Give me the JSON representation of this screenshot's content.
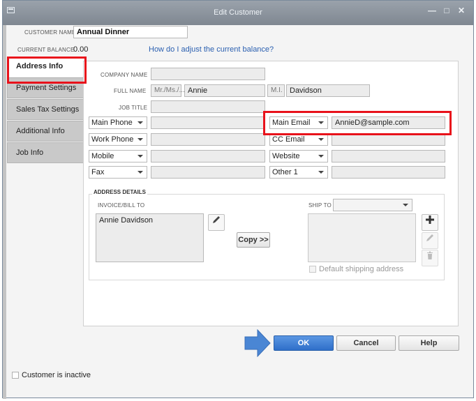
{
  "window": {
    "title": "Edit Customer",
    "minimize": "—",
    "restore": "□",
    "close": "✕"
  },
  "customer": {
    "name_label": "CUSTOMER NAME",
    "name_value": "Annual Dinner",
    "balance_label": "CURRENT BALANCE",
    "balance_value": "0.00",
    "balance_link": "How do I adjust the current balance?"
  },
  "tabs": [
    {
      "label": "Address Info"
    },
    {
      "label": "Payment Settings"
    },
    {
      "label": "Sales Tax Settings"
    },
    {
      "label": "Additional Info"
    },
    {
      "label": "Job Info"
    }
  ],
  "form": {
    "company_label": "COMPANY NAME",
    "company_value": "",
    "fullname_label": "FULL NAME",
    "salutation_placeholder": "Mr./Ms./...",
    "first_name": "Annie",
    "mi_placeholder": "M.I.",
    "last_name": "Davidson",
    "jobtitle_label": "JOB TITLE",
    "jobtitle_value": "",
    "phones": [
      {
        "type": "Main Phone",
        "value": ""
      },
      {
        "type": "Work Phone",
        "value": ""
      },
      {
        "type": "Mobile",
        "value": ""
      },
      {
        "type": "Fax",
        "value": ""
      }
    ],
    "contacts": [
      {
        "type": "Main Email",
        "value": "AnnieD@sample.com"
      },
      {
        "type": "CC Email",
        "value": ""
      },
      {
        "type": "Website",
        "value": ""
      },
      {
        "type": "Other 1",
        "value": ""
      }
    ]
  },
  "address": {
    "section_label": "ADDRESS DETAILS",
    "bill_label": "INVOICE/BILL TO",
    "bill_value": "Annie Davidson",
    "ship_label": "SHIP TO",
    "ship_value": "",
    "copy_button": "Copy >>",
    "default_shipping_label": "Default shipping address"
  },
  "footer": {
    "ok": "OK",
    "cancel": "Cancel",
    "help": "Help",
    "inactive_label": "Customer is inactive"
  },
  "colors": {
    "highlight": "#e8121b",
    "primary": "#2f6fc9",
    "arrow": "#4a86d4",
    "link": "#2a5fb0"
  }
}
